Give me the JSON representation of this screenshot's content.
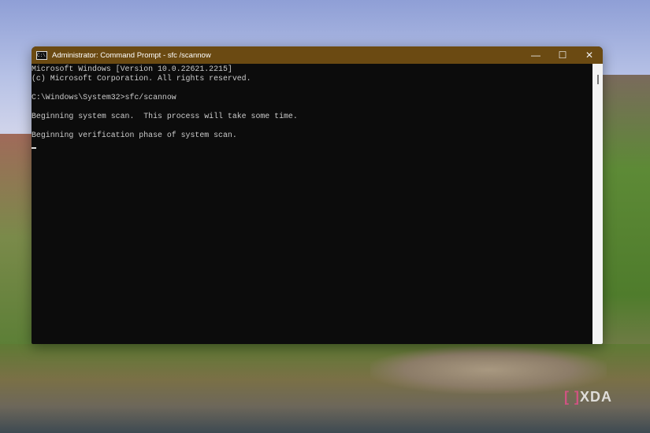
{
  "window": {
    "title": "Administrator: Command Prompt - sfc /scannow",
    "icon": "cmd-icon",
    "controls": {
      "minimize": "—",
      "maximize": "☐",
      "close": "✕"
    },
    "accent_color": "#6b4a12"
  },
  "console": {
    "lines": [
      "Microsoft Windows [Version 10.0.22621.2215]",
      "(c) Microsoft Corporation. All rights reserved.",
      "",
      "C:\\Windows\\System32>sfc/scannow",
      "",
      "Beginning system scan.  This process will take some time.",
      "",
      "Beginning verification phase of system scan."
    ]
  },
  "watermark": {
    "text": "XDA",
    "bracket": "[ ]"
  }
}
